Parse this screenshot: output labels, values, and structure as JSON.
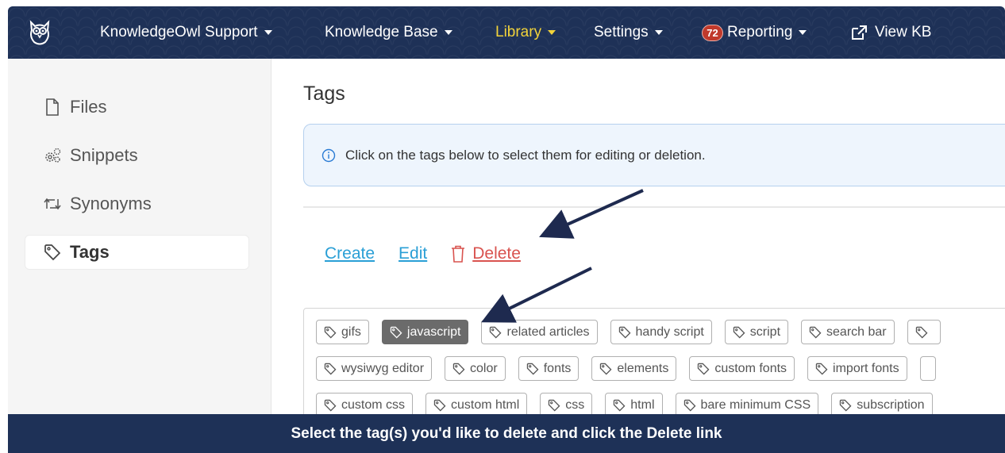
{
  "navbar": {
    "items": [
      {
        "label": "KnowledgeOwl Support",
        "icon": ""
      },
      {
        "label": "Knowledge Base"
      },
      {
        "label": "Library"
      },
      {
        "label": "Settings"
      },
      {
        "label": "Reporting",
        "badge": "72"
      },
      {
        "label": "View KB"
      }
    ]
  },
  "sidebar": {
    "items": [
      {
        "label": "Files",
        "icon": "file-icon"
      },
      {
        "label": "Snippets",
        "icon": "gears-icon"
      },
      {
        "label": "Synonyms",
        "icon": "swap-icon"
      },
      {
        "label": "Tags",
        "icon": "tag-icon"
      }
    ]
  },
  "main": {
    "title": "Tags",
    "alert": "Click on the tags below to select them for editing or deletion.",
    "actions": {
      "create": "Create",
      "edit": "Edit",
      "delete": "Delete"
    },
    "tags": [
      [
        "gifs",
        "javascript",
        "related articles",
        "handy script",
        "script",
        "search bar"
      ],
      [
        "wysiwyg editor",
        "color",
        "fonts",
        "elements",
        "custom fonts",
        "import fonts"
      ],
      [
        "custom css",
        "custom html",
        "css",
        "html",
        "bare minimum CSS",
        "subscription"
      ]
    ],
    "selected_tag": "javascript"
  },
  "caption": "Select the tag(s) you'd like to delete and click the Delete link",
  "colors": {
    "navy": "#1e3157",
    "link": "#2a9fd6",
    "danger": "#d9534f",
    "active_nav": "#f2d33a"
  }
}
